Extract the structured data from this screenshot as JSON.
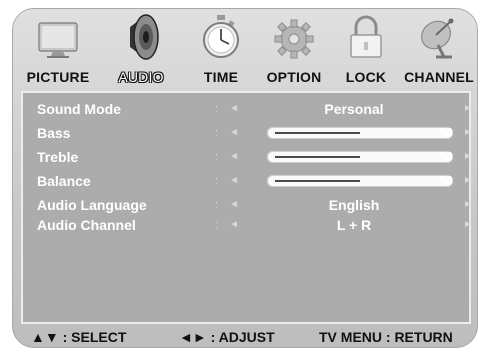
{
  "tabs": [
    {
      "label": "PICTURE",
      "icon": "tv-icon"
    },
    {
      "label": "AUDIO",
      "icon": "speaker-icon"
    },
    {
      "label": "TIME",
      "icon": "stopwatch-icon"
    },
    {
      "label": "OPTION",
      "icon": "gear-icon"
    },
    {
      "label": "LOCK",
      "icon": "padlock-icon"
    },
    {
      "label": "CHANNEL",
      "icon": "satellite-dish-icon"
    }
  ],
  "active_tab": "AUDIO",
  "menu": {
    "colon": ":",
    "left_arrow": "◄",
    "right_arrow": "►",
    "sound_mode": {
      "label": "Sound Mode",
      "value": "Personal"
    },
    "bass": {
      "label": "Bass",
      "value": "50",
      "level": 0.5
    },
    "treble": {
      "label": "Treble",
      "value": "50",
      "level": 0.5
    },
    "balance": {
      "label": "Balance",
      "value": "50",
      "level": 0.5
    },
    "audio_language": {
      "label": "Audio Language",
      "value": "English"
    },
    "audio_channel": {
      "label": "Audio Channel",
      "value": "L + R"
    }
  },
  "footer": {
    "select": "▲▼ : SELECT",
    "adjust": "◄► : ADJUST",
    "return": "TV MENU : RETURN"
  },
  "colors": {
    "panel": "#acacac",
    "frame": "#d2d2d2",
    "text": "#ffffff"
  }
}
